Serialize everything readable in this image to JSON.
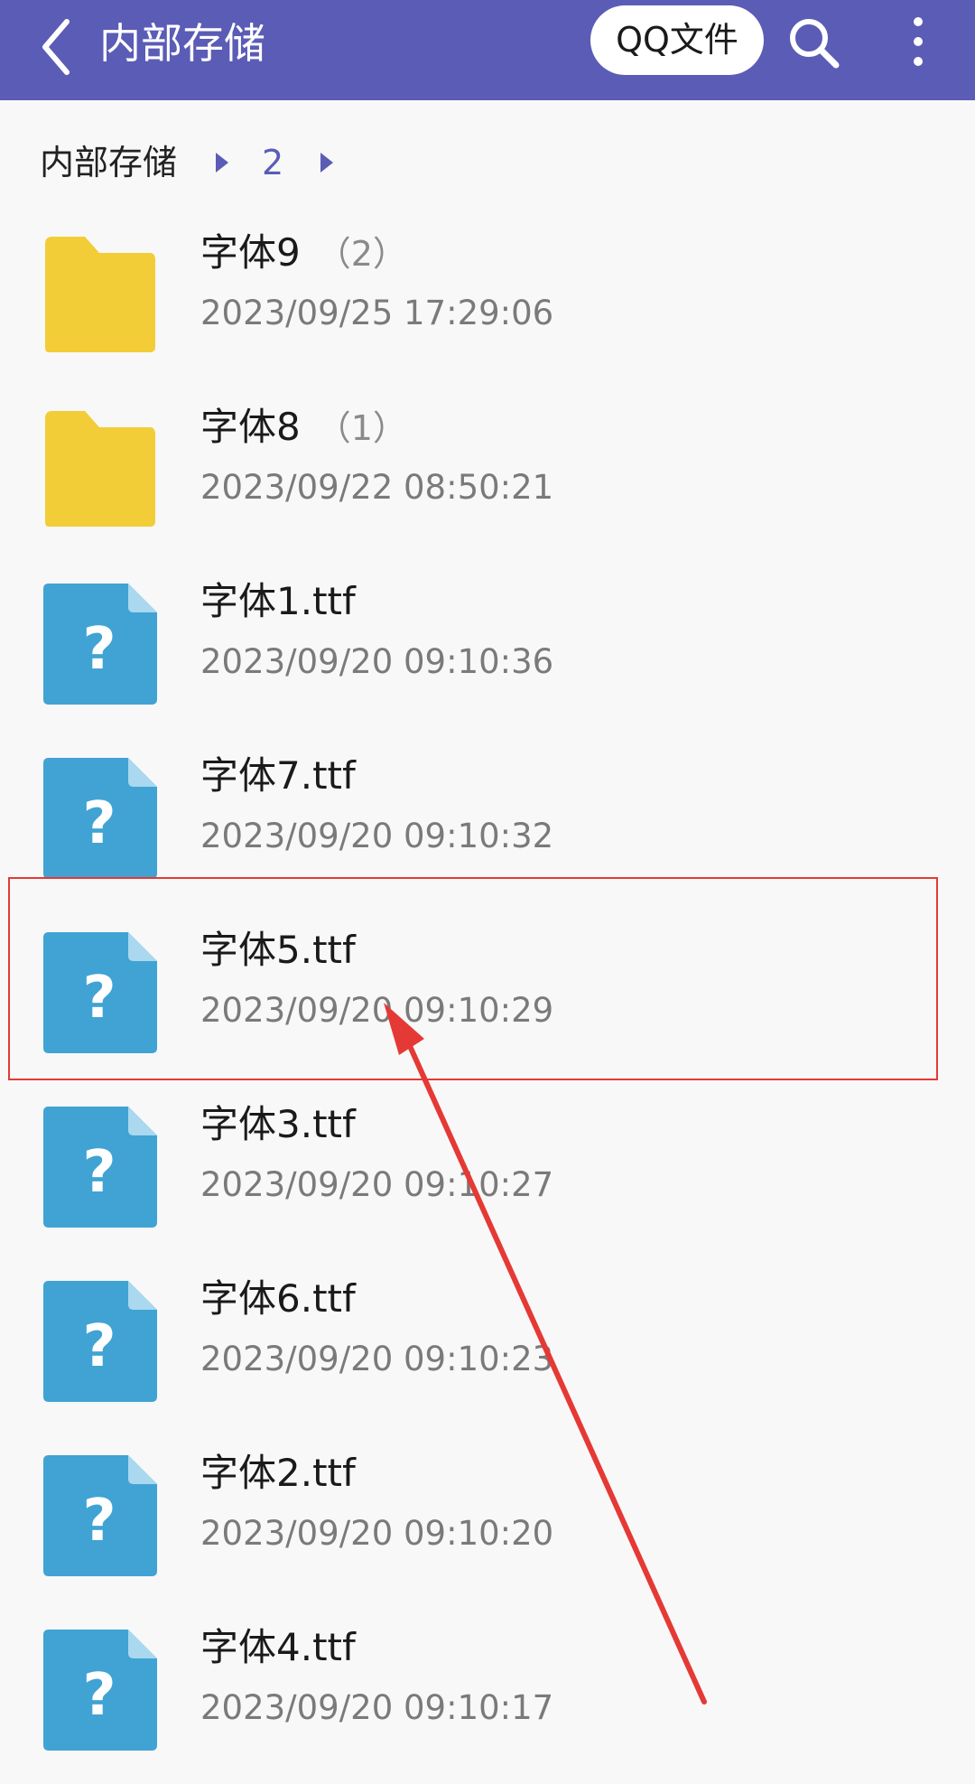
{
  "appbar": {
    "title": "内部存储",
    "qq_button_label": "QQ文件"
  },
  "breadcrumb": {
    "root": "内部存储",
    "current": "2"
  },
  "colors": {
    "appbar": "#5b5cb6",
    "folder": "#f2cd37",
    "file": "#40a3d3",
    "annotation": "#e53935"
  },
  "files": [
    {
      "name": "字体9",
      "count": "（2）",
      "date": "2023/09/25 17:29:06",
      "type": "folder"
    },
    {
      "name": "字体8",
      "count": "（1）",
      "date": "2023/09/22 08:50:21",
      "type": "folder"
    },
    {
      "name": "字体1.ttf",
      "count": "",
      "date": "2023/09/20 09:10:36",
      "type": "file"
    },
    {
      "name": "字体7.ttf",
      "count": "",
      "date": "2023/09/20 09:10:32",
      "type": "file"
    },
    {
      "name": "字体5.ttf",
      "count": "",
      "date": "2023/09/20 09:10:29",
      "type": "file"
    },
    {
      "name": "字体3.ttf",
      "count": "",
      "date": "2023/09/20 09:10:27",
      "type": "file"
    },
    {
      "name": "字体6.ttf",
      "count": "",
      "date": "2023/09/20 09:10:23",
      "type": "file"
    },
    {
      "name": "字体2.ttf",
      "count": "",
      "date": "2023/09/20 09:10:20",
      "type": "file"
    },
    {
      "name": "字体4.ttf",
      "count": "",
      "date": "2023/09/20 09:10:17",
      "type": "file"
    }
  ]
}
